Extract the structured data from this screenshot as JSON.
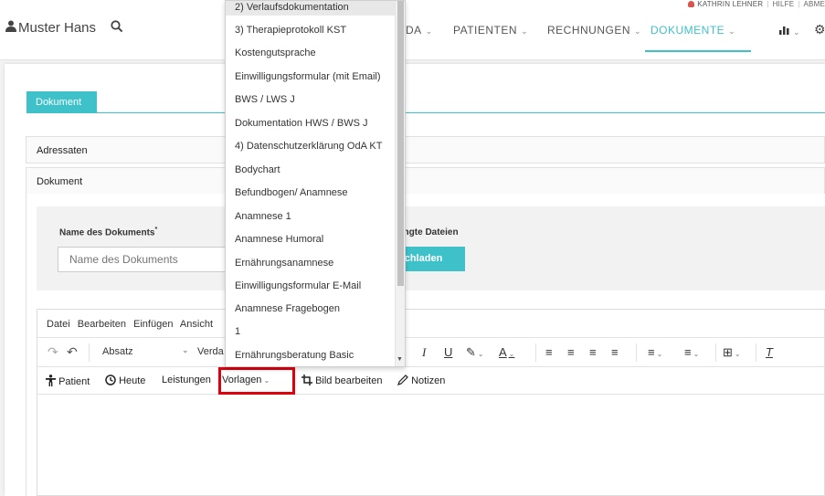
{
  "header": {
    "user_name": "KATHRIN LEHNER",
    "help": "HILFE",
    "logout_partial": "ABME",
    "brand": "Muster Hans",
    "nav": [
      {
        "label": "DA"
      },
      {
        "label": "PATIENTEN"
      },
      {
        "label": "RECHNUNGEN"
      },
      {
        "label": "DOKUMENTE",
        "active": true
      }
    ]
  },
  "tab": {
    "label": "Dokument"
  },
  "sections": {
    "adressaten": "Adressaten",
    "dokument": "Dokument"
  },
  "form": {
    "name_label": "Name des Dokuments",
    "name_required": "*",
    "name_placeholder": "Name des Dokuments",
    "files_label": "ängte Dateien",
    "upload_label": "ochladen"
  },
  "editor": {
    "menus": [
      "Datei",
      "Bearbeiten",
      "Einfügen",
      "Ansicht"
    ],
    "block_format": "Absatz",
    "font_partial": "Verda",
    "toolbar2": {
      "patient": "Patient",
      "heute": "Heute",
      "leistungen": "Leistungen",
      "vorlagen": "Vorlagen",
      "bild": "Bild bearbeiten",
      "notizen": "Notizen"
    }
  },
  "dropdown": {
    "items": [
      "2) Verlaufsdokumentation",
      "3) Therapieprotokoll KST",
      "Kostengutsprache",
      "Einwilligungsformular (mit Email)",
      "BWS / LWS J",
      "Dokumentation HWS / BWS J",
      "4) Datenschutzerklärung OdA KT",
      "Bodychart",
      "Befundbogen/ Anamnese",
      "Anamnese 1",
      "Anamnese Humoral",
      "Ernährungsanamnese",
      "Einwilligungsformular E-Mail",
      "Anamnese Fragebogen",
      "1",
      "Ernährungsberatung Basic"
    ]
  },
  "colors": {
    "accent": "#3fc1c9",
    "highlight": "#e0000d"
  }
}
